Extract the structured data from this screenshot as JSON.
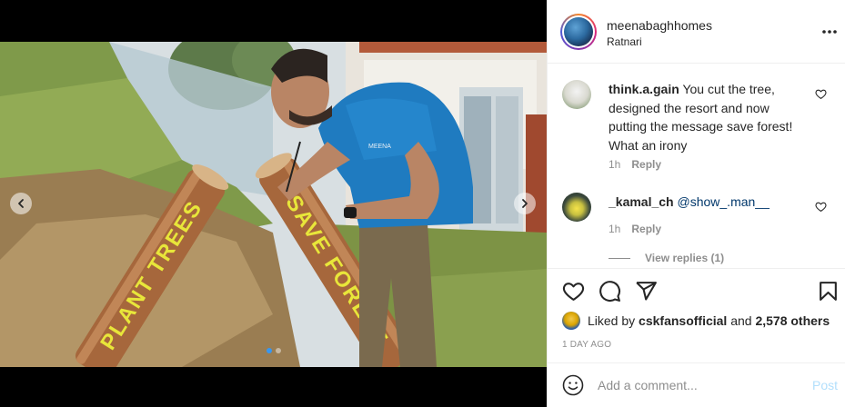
{
  "post": {
    "username": "meenabaghhomes",
    "location": "Ratnari",
    "time_ago": "1 DAY AGO"
  },
  "media": {
    "log_text_left": "PLANT TREES",
    "log_text_right": "SAVE FOREST",
    "shirt_text": "MEENA",
    "carousel_slide": 1,
    "carousel_total": 2
  },
  "comments": [
    {
      "username": "think.a.gain",
      "text": "You cut the tree, designed the resort and now putting the message save forest! What an irony",
      "time": "1h",
      "reply_label": "Reply"
    },
    {
      "username": "_kamal_ch",
      "mention": "@show_.man__",
      "text": "",
      "time": "1h",
      "reply_label": "Reply"
    }
  ],
  "view_replies": "View replies (1)",
  "likes": {
    "prefix": "Liked by",
    "top_user": "cskfansofficial",
    "connector": "and",
    "others": "2,578 others"
  },
  "composer": {
    "placeholder": "Add a comment...",
    "post_label": "Post"
  },
  "icons": {
    "more": "more-options-icon",
    "like": "heart-icon",
    "comment": "comment-bubble-icon",
    "share": "paper-plane-icon",
    "save": "bookmark-icon",
    "emoji": "emoji-smiley-icon",
    "prev": "chevron-left-icon",
    "next": "chevron-right-icon"
  },
  "colors": {
    "link_blue": "#00376b",
    "post_disabled": "#b2dffc",
    "active_dot": "#3897f0",
    "log_paint": "#e8e63a"
  }
}
